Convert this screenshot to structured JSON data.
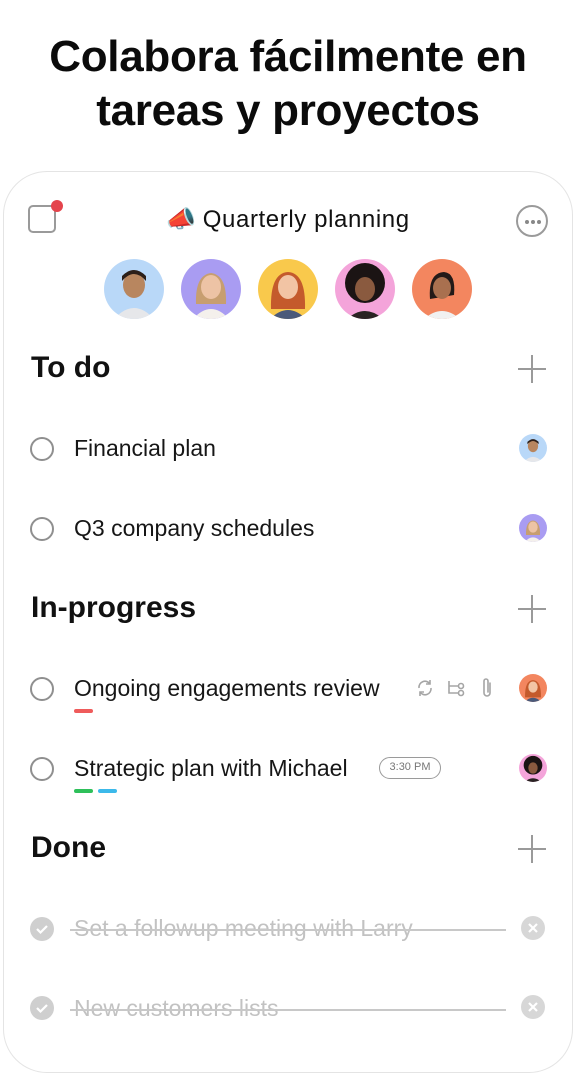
{
  "headline": {
    "line1": "Colabora fácilmente en",
    "line2": "tareas y proyectos"
  },
  "project": {
    "emoji": "📣",
    "title": "Quarterly planning",
    "icons": [
      "notebook-icon",
      "more-icon"
    ]
  },
  "members": [
    {
      "name": "member-1",
      "bg": "#b9d8f8"
    },
    {
      "name": "member-2",
      "bg": "#a99cf2"
    },
    {
      "name": "member-3",
      "bg": "#f9c94c"
    },
    {
      "name": "member-4",
      "bg": "#f4a4da"
    },
    {
      "name": "member-5",
      "bg": "#f3865f"
    }
  ],
  "sections": [
    {
      "title": "To do",
      "tasks": [
        {
          "label": "Financial plan",
          "assignee_bg": "#b9d8f8"
        },
        {
          "label": "Q3 company schedules",
          "assignee_bg": "#a99cf2"
        }
      ]
    },
    {
      "title": "In-progress",
      "tasks": [
        {
          "label": "Ongoing engagements review",
          "assignee_bg": "#f3865f",
          "tags": [
            "#ef5b5b"
          ],
          "meta_icons": [
            "recurring-icon",
            "subtask-icon",
            "attachment-icon"
          ]
        },
        {
          "label": "Strategic plan with Michael",
          "assignee_bg": "#f4a4da",
          "tags": [
            "#2ec05a",
            "#3cb9ea"
          ],
          "time": "3:30 PM"
        }
      ]
    },
    {
      "title": "Done",
      "tasks": [
        {
          "label": "Set a followup meeting with Larry"
        },
        {
          "label": "New customers lists"
        }
      ]
    }
  ]
}
